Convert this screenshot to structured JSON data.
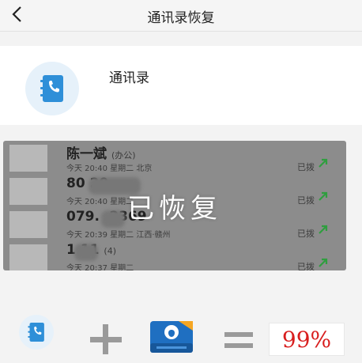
{
  "header": {
    "title": "通讯录恢复"
  },
  "card": {
    "title": "通讯录",
    "icon": "contacts-book-icon"
  },
  "records": [
    {
      "name": "陈一斌",
      "tag": "(办公)",
      "info": "今天 20:40  星期二  北京",
      "status": "已拨"
    },
    {
      "name": "80          20",
      "tag": "",
      "info": "今天 20:40  星期二",
      "status": "已拨"
    },
    {
      "name": "079.   .2369",
      "tag": "",
      "info": "今天 20:39  星期二  江西·赣州",
      "status": "已拨"
    },
    {
      "name": "1    11",
      "tag": "(4)",
      "info": "今天 20:37  星期二",
      "status": "已拨"
    }
  ],
  "overlay": {
    "text": "已恢复"
  },
  "equation": {
    "left_icon": "contacts-book-icon",
    "right_icon": "backup-drive-icon",
    "result": "99%"
  },
  "colors": {
    "accent": "#2e8fd8",
    "result": "#d81e1e",
    "called_arrow": "#2f9e3f"
  }
}
